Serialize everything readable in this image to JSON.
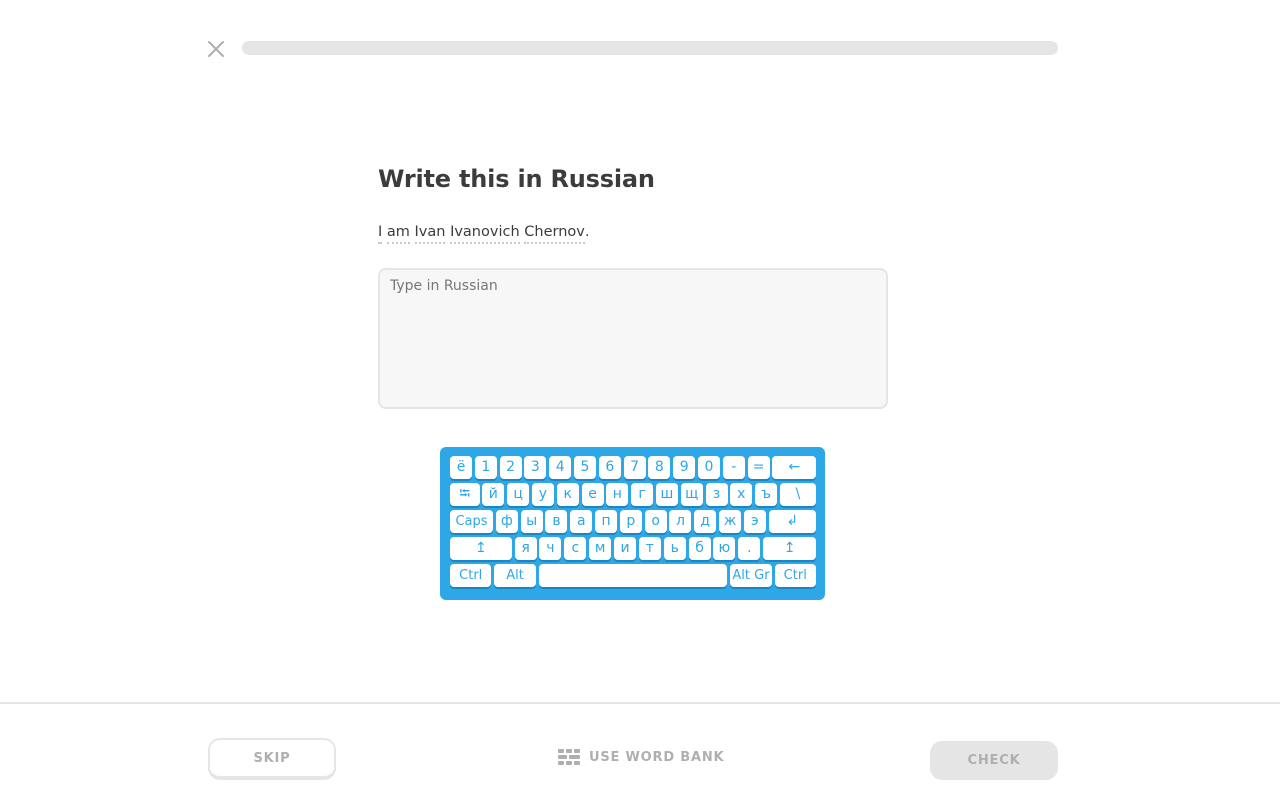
{
  "header": {
    "close_icon": "close-icon",
    "progress": 0
  },
  "challenge": {
    "title": "Write this in Russian",
    "prompt_words": [
      "I",
      "am",
      "Ivan",
      "Ivanovich",
      "Chernov"
    ],
    "prompt_end": ".",
    "answer_value": "",
    "answer_placeholder": "Type in Russian"
  },
  "keyboard": {
    "rows": [
      [
        "ё",
        "1",
        "2",
        "3",
        "4",
        "5",
        "6",
        "7",
        "8",
        "9",
        "0",
        "-",
        "=",
        "←"
      ],
      [
        "⭾",
        "й",
        "ц",
        "у",
        "к",
        "е",
        "н",
        "г",
        "ш",
        "щ",
        "з",
        "х",
        "ъ",
        "\\"
      ],
      [
        "Caps",
        "ф",
        "ы",
        "в",
        "а",
        "п",
        "р",
        "о",
        "л",
        "д",
        "ж",
        "э",
        "↲"
      ],
      [
        "↥",
        "я",
        "ч",
        "с",
        "м",
        "и",
        "т",
        "ь",
        "б",
        "ю",
        ".",
        "↥"
      ],
      [
        "Ctrl",
        "Alt",
        " ",
        "Alt Gr",
        "Ctrl"
      ]
    ]
  },
  "footer": {
    "skip_label": "SKIP",
    "word_bank_label": "USE WORD BANK",
    "word_bank_icon": "word-bank-icon",
    "check_label": "CHECK"
  },
  "colors": {
    "keyboard_blue": "#2ea7e6",
    "disabled_gray": "#e5e5e5",
    "muted_text": "#afafaf"
  }
}
